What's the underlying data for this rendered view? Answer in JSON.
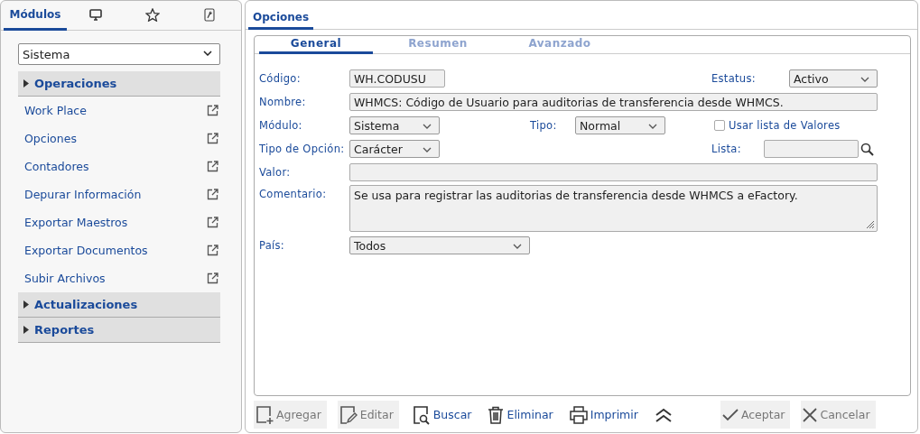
{
  "sidebar": {
    "tabs": [
      {
        "label": "Módulos",
        "selected": true
      },
      {
        "selected": false
      },
      {
        "selected": false
      },
      {
        "selected": false
      }
    ],
    "module_select": {
      "value": "Sistema"
    },
    "sections": [
      {
        "title": "Operaciones",
        "children": [
          {
            "label": "Work Place"
          },
          {
            "label": "Opciones"
          },
          {
            "label": "Contadores"
          },
          {
            "label": "Depurar Información"
          },
          {
            "label": "Exportar Maestros"
          },
          {
            "label": "Exportar Documentos"
          },
          {
            "label": "Subir Archivos"
          }
        ]
      },
      {
        "title": "Actualizaciones"
      },
      {
        "title": "Reportes"
      }
    ]
  },
  "main": {
    "tabs": [
      {
        "label": "Opciones",
        "selected": true
      }
    ],
    "subtabs": [
      {
        "label": "General",
        "selected": true
      },
      {
        "label": "Resumen",
        "selected": false
      },
      {
        "label": "Avanzado",
        "selected": false
      }
    ],
    "form_rows": [
      {
        "items": [
          {
            "kind": "label",
            "text": "Código:"
          },
          {
            "kind": "text",
            "value": "WH.CODUSU"
          },
          {
            "kind": "label",
            "text": "Estatus:"
          },
          {
            "kind": "select",
            "value": "Activo"
          }
        ]
      },
      {
        "items": [
          {
            "kind": "label",
            "text": "Nombre:"
          },
          {
            "kind": "text",
            "value": "WHMCS: Código de Usuario para auditorias de transferencia desde WHMCS."
          }
        ]
      },
      {
        "items": [
          {
            "kind": "label",
            "text": "Módulo:"
          },
          {
            "kind": "select",
            "value": "Sistema"
          },
          {
            "kind": "label",
            "text": "Tipo:"
          },
          {
            "kind": "select",
            "value": "Normal"
          },
          {
            "kind": "checkbox",
            "text": "Usar lista de Valores",
            "checked": false
          }
        ]
      },
      {
        "items": [
          {
            "kind": "label",
            "text": "Tipo de Opción:"
          },
          {
            "kind": "select",
            "value": "Carácter"
          },
          {
            "kind": "label",
            "text": "Lista:"
          },
          {
            "kind": "search"
          }
        ]
      },
      {
        "items": [
          {
            "kind": "label",
            "text": "Valor:"
          },
          {
            "kind": "text"
          }
        ]
      },
      {
        "items": [
          {
            "kind": "label",
            "text": "Comentario:"
          },
          {
            "kind": "textarea",
            "value": "Se usa para registrar las auditorias de transferencia desde WHMCS a eFactory."
          }
        ]
      },
      {
        "items": [
          {
            "kind": "label",
            "text": "País:"
          },
          {
            "kind": "select",
            "value": "Todos"
          }
        ]
      }
    ],
    "toolbar": [
      {
        "label": "Agregar",
        "disabled": true
      },
      {
        "label": "Editar",
        "disabled": true
      },
      {
        "label": "Buscar",
        "disabled": false
      },
      {
        "label": "Eliminar",
        "disabled": false
      },
      {
        "label": "Imprimir",
        "disabled": false
      },
      {
        "disabled": false
      },
      {
        "label": "Aceptar",
        "disabled": true
      },
      {
        "label": "Cancelar",
        "disabled": true
      }
    ]
  }
}
